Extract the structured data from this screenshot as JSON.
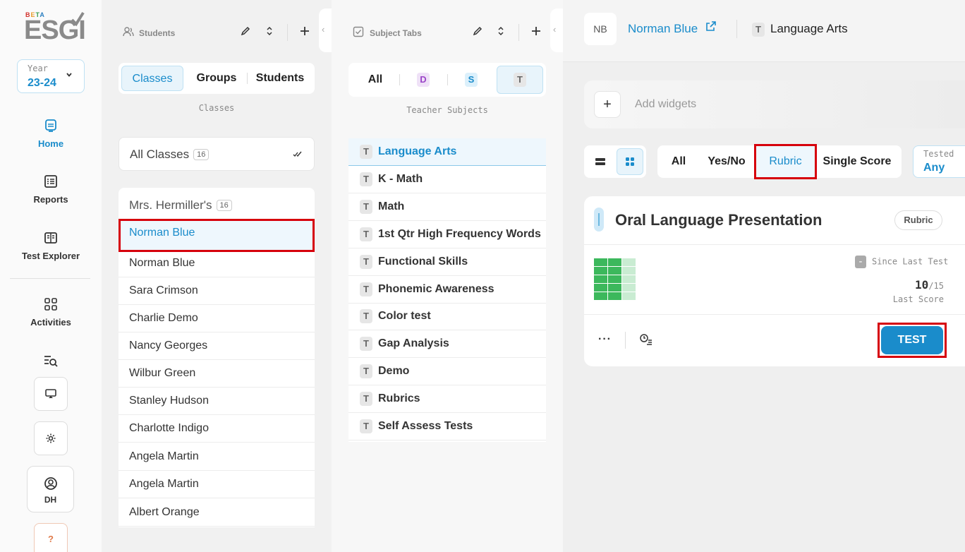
{
  "nav": {
    "logo_beta": "BETA",
    "logo_text": "ESGI",
    "year_label": "Year",
    "year_value": "23-24",
    "items": [
      {
        "label": "Home",
        "active": true
      },
      {
        "label": "Reports"
      },
      {
        "label": "Test Explorer"
      },
      {
        "label": "Activities"
      }
    ],
    "user_initials": "DH",
    "help": "?"
  },
  "students_panel": {
    "title": "Students",
    "tabs": [
      "Classes",
      "Groups",
      "Students"
    ],
    "active_tab": "Classes",
    "caption": "Classes",
    "all_classes": {
      "label": "All Classes",
      "count": "16"
    },
    "class": {
      "name": "Mrs. Hermiller's",
      "count": "16"
    },
    "students": [
      "Norman Blue",
      "Norman Blue",
      "Sara Crimson",
      "Charlie Demo",
      "Nancy Georges",
      "Wilbur Green",
      "Stanley Hudson",
      "Charlotte Indigo",
      "Angela Martin",
      "Angela Martin",
      "Albert Orange"
    ]
  },
  "subjects_panel": {
    "title": "Subject Tabs",
    "tabs": {
      "all": "All",
      "d": "D",
      "s": "S",
      "t": "T"
    },
    "caption": "Teacher Subjects",
    "subjects": [
      "Language Arts",
      "K - Math",
      "Math",
      "1st Qtr High Frequency Words",
      "Functional Skills",
      "Phonemic Awareness",
      "Color test",
      "Gap Analysis",
      "Demo",
      "Rubrics",
      "Self Assess Tests"
    ],
    "chip": "T"
  },
  "main": {
    "avatar": "NB",
    "student_name": "Norman Blue",
    "subject_chip": "T",
    "subject_name": "Language Arts",
    "add_widgets": "Add widgets",
    "add_plus": "+",
    "filters": [
      "All",
      "Yes/No",
      "Rubric",
      "Single Score"
    ],
    "active_filter": "Rubric",
    "tested_label": "Tested",
    "tested_value": "Any",
    "card": {
      "title": "Oral Language Presentation",
      "type_badge": "Rubric",
      "since_label": "Since Last Test",
      "since_sign": "-",
      "score": "10",
      "score_total": "/15",
      "score_label": "Last Score",
      "more": "···",
      "test_button": "TEST"
    }
  },
  "colors": {
    "accent": "#1a8ccb",
    "highlight": "#d6000c",
    "grid_filled": "#3cb85c",
    "grid_empty": "#c9ecd2"
  }
}
